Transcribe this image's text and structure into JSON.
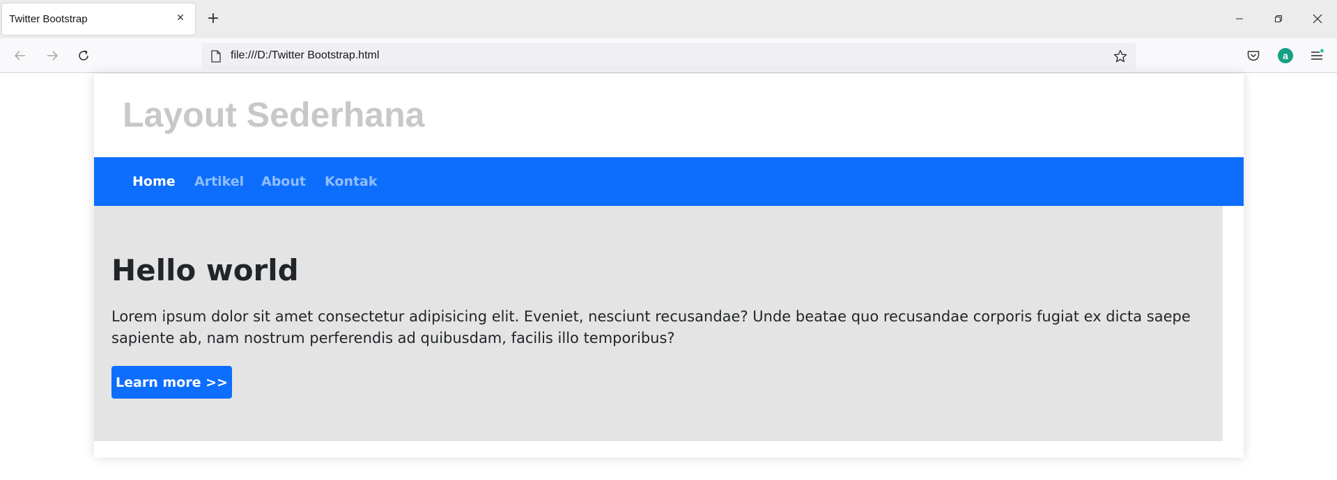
{
  "browser": {
    "tab_title": "Twitter Bootstrap",
    "url": "file:///D:/Twitter Bootstrap.html",
    "account_initial": "a"
  },
  "site": {
    "title": "Layout Sederhana",
    "nav": [
      {
        "label": "Home",
        "active": true
      },
      {
        "label": "Artikel",
        "active": false
      },
      {
        "label": "About",
        "active": false
      },
      {
        "label": "Kontak",
        "active": false
      }
    ],
    "hero": {
      "title": "Hello world",
      "text": "Lorem ipsum dolor sit amet consectetur adipisicing elit. Eveniet, nesciunt recusandae? Unde beatae quo recusandae corporis fugiat ex dicta saepe sapiente ab, nam nostrum perferendis ad quibusdam, facilis illo temporibus?",
      "button_label": "Learn more >>"
    }
  },
  "colors": {
    "primary": "#0d6efd",
    "jumbotron_bg": "#e4e4e4",
    "title_gray": "#c8c8c8"
  },
  "icons": [
    "close-icon",
    "plus-icon",
    "minimize-icon",
    "restore-icon",
    "window-close-icon",
    "back-arrow-icon",
    "forward-arrow-icon",
    "reload-icon",
    "page-icon",
    "star-icon",
    "pocket-icon",
    "account-icon",
    "menu-icon"
  ]
}
